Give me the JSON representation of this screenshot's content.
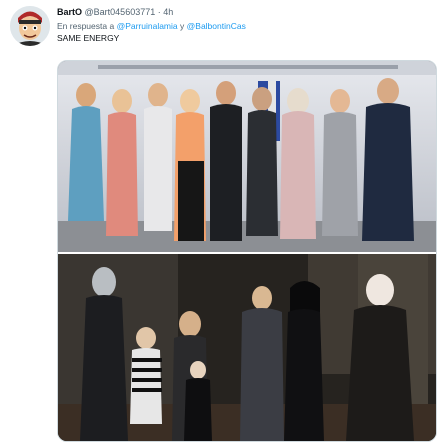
{
  "tweet": {
    "display_name": "BartO",
    "handle": "@Bart045603771",
    "separator": "·",
    "time": "4h",
    "reply_prefix": "En respuesta a",
    "mention_1": "@Parruinalamia",
    "reply_join": "y",
    "mention_2": "@BalbontinCas",
    "text": "SAME ENERGY"
  },
  "colors": {
    "mention": "#1d9bf0",
    "secondary_text": "#536471"
  },
  "icons": {
    "avatar": "cartoon-character-avatar"
  }
}
